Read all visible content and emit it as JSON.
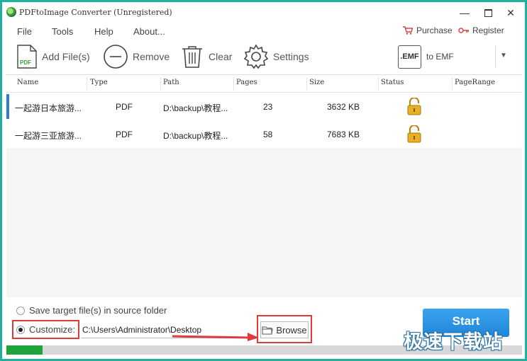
{
  "window": {
    "title": "PDFtoImage Converter (Unregistered)",
    "min_glyph": "—",
    "close_glyph": "✕"
  },
  "menu": {
    "file": "File",
    "tools": "Tools",
    "help": "Help",
    "about": "About...",
    "purchase": "Purchase",
    "register": "Register"
  },
  "toolbar": {
    "add_files": "Add File(s)",
    "remove": "Remove",
    "clear": "Clear",
    "settings": "Settings",
    "emf_icon": ".EMF",
    "format": "to EMF",
    "dropdown_glyph": "▼"
  },
  "table": {
    "columns": [
      "Name",
      "Type",
      "Path",
      "Pages",
      "Size",
      "Status",
      "PageRange"
    ],
    "rows": [
      {
        "name": "一起游日本旅游...",
        "type": "PDF",
        "path": "D:\\backup\\教程...",
        "pages": "23",
        "size": "3632 KB",
        "status": "lock-icon",
        "page_range": ""
      },
      {
        "name": "一起游三亚旅游...",
        "type": "PDF",
        "path": "D:\\backup\\教程...",
        "pages": "58",
        "size": "7683 KB",
        "status": "lock-icon",
        "page_range": ""
      }
    ]
  },
  "output": {
    "save_source_label": "Save target file(s) in source folder",
    "customize_label": "Customize:",
    "customize_selected": true,
    "path_value": "C:\\Users\\Administrator\\Desktop",
    "browse_label": "Browse"
  },
  "start_label": "Start",
  "progress_percent": 7,
  "watermark": "极速下载站",
  "colors": {
    "accent_blue": "#1f86d8",
    "annotation_red": "#e03a3a",
    "progress_green": "#1fa43c",
    "lock_gold": "#e8b020"
  }
}
